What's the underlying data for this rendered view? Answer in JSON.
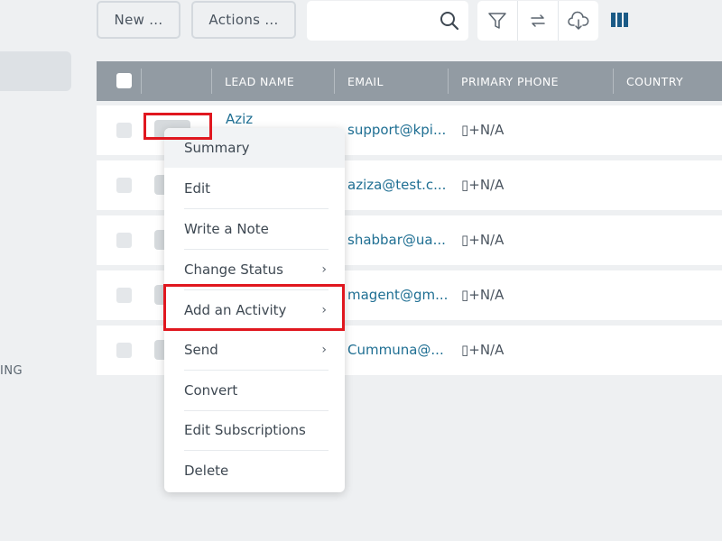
{
  "sidebar": {
    "partial_label": "ING"
  },
  "toolbar": {
    "new_label": "New ...",
    "actions_label": "Actions ...",
    "search_placeholder": "",
    "tools": [
      "filter-icon",
      "refresh-icon",
      "download-cloud-icon"
    ],
    "columns_icon": "columns-icon"
  },
  "table": {
    "headers": [
      "LEAD NAME",
      "EMAIL",
      "PRIMARY PHONE",
      "COUNTRY"
    ],
    "rows": [
      {
        "name": "Aziz",
        "email": "support@kpi...",
        "phone": "+N/A"
      },
      {
        "name": "",
        "email": "aziza@test.c...",
        "phone": "+N/A"
      },
      {
        "name": "",
        "email": "shabbar@ua...",
        "phone": "+N/A"
      },
      {
        "name": "",
        "email": "magent@gm...",
        "phone": "+N/A"
      },
      {
        "name": "",
        "email": "Cummuna@...",
        "phone": "+N/A"
      }
    ]
  },
  "context_menu": {
    "items": [
      {
        "label": "Summary",
        "submenu": false
      },
      {
        "label": "Edit",
        "submenu": false
      },
      {
        "label": "Write a Note",
        "submenu": false
      },
      {
        "label": "Change Status",
        "submenu": true
      },
      {
        "label": "Add an Activity",
        "submenu": true
      },
      {
        "label": "Send",
        "submenu": true
      },
      {
        "label": "Convert",
        "submenu": false
      },
      {
        "label": "Edit Subscriptions",
        "submenu": false
      },
      {
        "label": "Delete",
        "submenu": false
      }
    ],
    "chevron": "›"
  },
  "colors": {
    "header_bg": "#929ba3",
    "link": "#1f6f93",
    "highlight": "#e0171f",
    "columns_icon": "#1a5a86"
  }
}
